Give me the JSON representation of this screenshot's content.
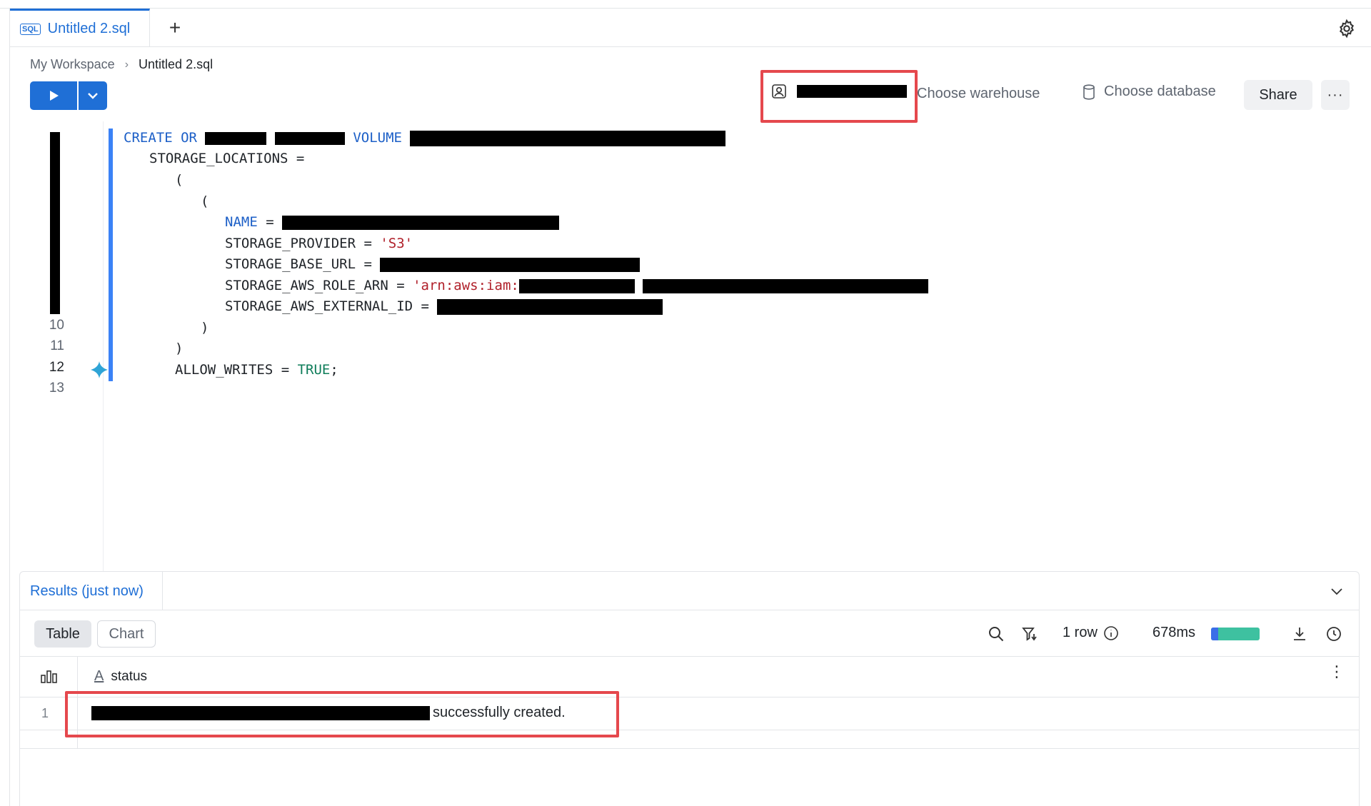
{
  "tabs": [
    {
      "label": "Untitled 2.sql",
      "icon": "sql-file-icon"
    }
  ],
  "new_tab_label": "+",
  "breadcrumb": {
    "workspace": "My Workspace",
    "separator": "›",
    "file": "Untitled 2.sql"
  },
  "toolbar": {
    "warehouse": "Choose warehouse",
    "database": "Choose database",
    "share": "Share",
    "more": "···"
  },
  "editor": {
    "line_numbers": [
      "10",
      "11",
      "12",
      "13"
    ],
    "lines": {
      "l1_create": "CREATE",
      "l1_or": "OR",
      "l1_volume": "VOLUME",
      "l2": "STORAGE_LOCATIONS =",
      "l3": "(",
      "l4": "(",
      "l5_name": "NAME",
      "l5_eq": "=",
      "l6_key": "STORAGE_PROVIDER = ",
      "l6_val": "'S3'",
      "l7_key": "STORAGE_BASE_URL =",
      "l8_key": "STORAGE_AWS_ROLE_ARN = ",
      "l8_val": "'arn:aws:iam:",
      "l9_key": "STORAGE_AWS_EXTERNAL_ID =",
      "l10": ")",
      "l11": ")",
      "l12_key": "ALLOW_WRITES = ",
      "l12_val": "TRUE",
      "l12_end": ";"
    }
  },
  "results": {
    "tab_label": "Results (just now)",
    "view_table": "Table",
    "view_chart": "Chart",
    "row_count": "1 row",
    "duration": "678ms",
    "column": "status",
    "column_type": "A",
    "rows": [
      {
        "num": "1",
        "status_suffix": "successfully created."
      }
    ]
  },
  "colors": {
    "accent": "#1f6fd6",
    "highlight": "#e5484d",
    "keyword": "#1c5fc7",
    "string": "#b0202a",
    "boolean": "#0f7d5a"
  }
}
